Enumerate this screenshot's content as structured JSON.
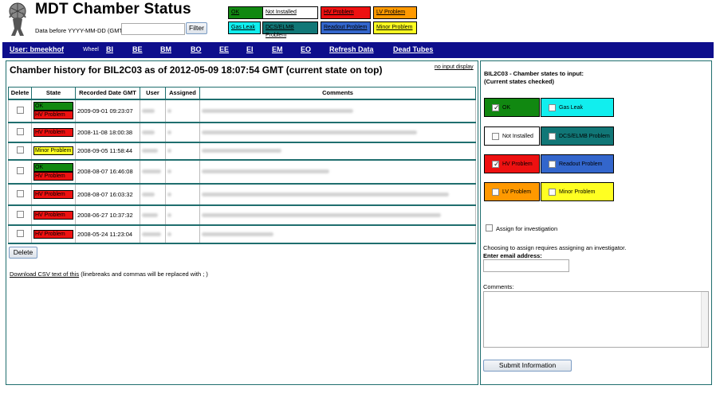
{
  "header": {
    "title": "MDT Chamber Status",
    "date_label": "Data before YYYY-MM-DD (GMT):",
    "date_value": "",
    "filter_label": "Filter"
  },
  "legend": [
    {
      "label": "OK",
      "bg": "#118811"
    },
    {
      "label": "Not Installed",
      "bg": "#ffffff"
    },
    {
      "label": "HV Problem",
      "bg": "#ee1111"
    },
    {
      "label": "LV Problem",
      "bg": "#ff9900"
    },
    {
      "label": "Gas Leak",
      "bg": "#11eeee"
    },
    {
      "label": "DCS/ELMB Problem",
      "bg": "#117777"
    },
    {
      "label": "Readout Problem",
      "bg": "#3366cc"
    },
    {
      "label": "Minor Problem",
      "bg": "#ffff22"
    }
  ],
  "nav": {
    "user": "User: bmeekhof",
    "wheel_label": "Wheel",
    "wheels": [
      "BI",
      "BE",
      "BM",
      "BO",
      "EE",
      "EI",
      "EM",
      "EO"
    ],
    "refresh": "Refresh Data",
    "dead_tubes": "Dead Tubes"
  },
  "history": {
    "title": "Chamber history for BIL2C03 as of 2012-05-09 18:07:54 GMT (current state on top)",
    "no_input_link": "no input display",
    "columns": [
      "Delete",
      "State",
      "Recorded Date GMT",
      "User",
      "Assigned",
      "Comments"
    ],
    "rows": [
      {
        "states": [
          "OK",
          "HV Problem"
        ],
        "date": "2009-09-01 09:23:07"
      },
      {
        "states": [
          "HV Problem"
        ],
        "date": "2008-11-08 18:00:38"
      },
      {
        "states": [
          "Minor Problem"
        ],
        "date": "2008-09-05 11:58:44"
      },
      {
        "states": [
          "OK",
          "HV Problem"
        ],
        "date": "2008-08-07 16:46:08"
      },
      {
        "states": [
          "HV Problem"
        ],
        "date": "2008-08-07 16:03:32"
      },
      {
        "states": [
          "HV Problem"
        ],
        "date": "2008-06-27 10:37:32"
      },
      {
        "states": [
          "HV Problem"
        ],
        "date": "2008-05-24 11:23:04"
      }
    ],
    "delete_label": "Delete",
    "csv_link": "Download CSV text of this",
    "csv_note": " (linebreaks and commas will be replaced with ; )"
  },
  "input": {
    "title_line1": "BIL2C03 - Chamber states to input:",
    "title_line2": "(Current states checked)",
    "states": [
      {
        "label": "OK",
        "bg": "#118811",
        "checked": true
      },
      {
        "label": "Gas Leak",
        "bg": "#11eeee",
        "checked": false
      },
      {
        "label": "Not Installed",
        "bg": "#ffffff",
        "checked": false
      },
      {
        "label": "DCS/ELMB Problem",
        "bg": "#117777",
        "checked": false
      },
      {
        "label": "HV Problem",
        "bg": "#ee1111",
        "checked": true
      },
      {
        "label": "Readout Problem",
        "bg": "#3366cc",
        "checked": false
      },
      {
        "label": "LV Problem",
        "bg": "#ff9900",
        "checked": false
      },
      {
        "label": "Minor Problem",
        "bg": "#ffff22",
        "checked": false
      }
    ],
    "assign_label": "Assign for investigation",
    "choose_line1": "Choosing to assign requires assigning an investigator.",
    "choose_line2": "Enter email address:",
    "email_value": "",
    "comments_label": "Comments:",
    "comments_value": "",
    "submit_label": "Submit Information"
  },
  "colors": {
    "nav_bg": "#0e0e8c",
    "border": "#1f6e6e"
  }
}
